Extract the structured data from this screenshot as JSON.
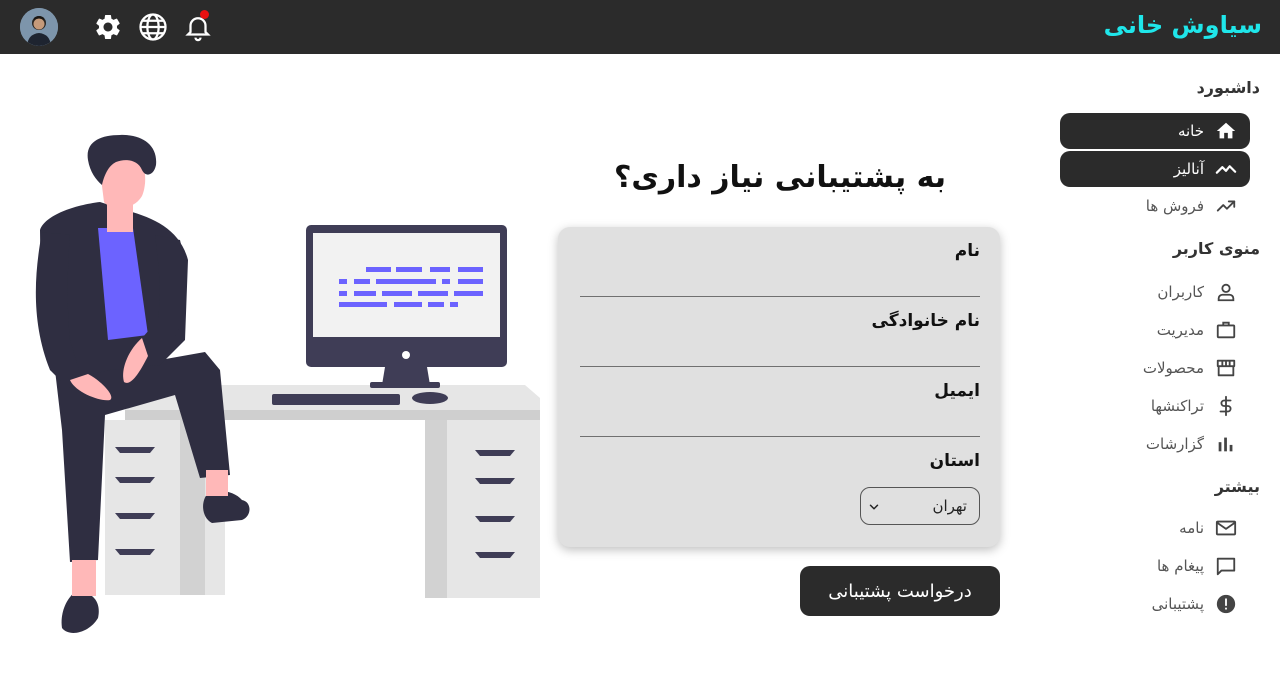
{
  "header": {
    "brand": "سیاوش خانی",
    "icons": [
      "avatar",
      "settings-icon",
      "globe-icon",
      "bell-icon"
    ],
    "has_notification": true,
    "brand_color": "#1fe6ea",
    "bar_color": "#2b2b2b"
  },
  "sidebar": {
    "sections": [
      {
        "title": "داشبورد",
        "items": [
          {
            "label": "خانه",
            "icon": "home-icon",
            "active": true
          },
          {
            "label": "آنالیز",
            "icon": "trend-icon",
            "active": true
          },
          {
            "label": "فروش ها",
            "icon": "trending-up-icon",
            "active": false
          }
        ]
      },
      {
        "title": "منوی کاربر",
        "items": [
          {
            "label": "کاربران",
            "icon": "user-icon",
            "active": false
          },
          {
            "label": "مدیریت",
            "icon": "briefcase-icon",
            "active": false
          },
          {
            "label": "محصولات",
            "icon": "store-icon",
            "active": false
          },
          {
            "label": "تراکنشها",
            "icon": "dollar-icon",
            "active": false
          },
          {
            "label": "گزارشات",
            "icon": "bar-chart-icon",
            "active": false
          }
        ]
      },
      {
        "title": "بیشتر",
        "items": [
          {
            "label": "نامه",
            "icon": "mail-icon",
            "active": false
          },
          {
            "label": "پیغام ها",
            "icon": "message-icon",
            "active": false
          },
          {
            "label": "پشتیبانی",
            "icon": "alert-icon",
            "active": false
          }
        ]
      }
    ]
  },
  "main": {
    "heading": "به پشتیبانی نیاز داری؟",
    "form": {
      "first_name": {
        "label": "نام",
        "value": ""
      },
      "last_name": {
        "label": "نام خانوادگی",
        "value": ""
      },
      "email": {
        "label": "ایمیل",
        "value": ""
      },
      "province": {
        "label": "استان",
        "selected": "تهران"
      }
    },
    "submit_label": "درخواست پشتیبانی"
  }
}
